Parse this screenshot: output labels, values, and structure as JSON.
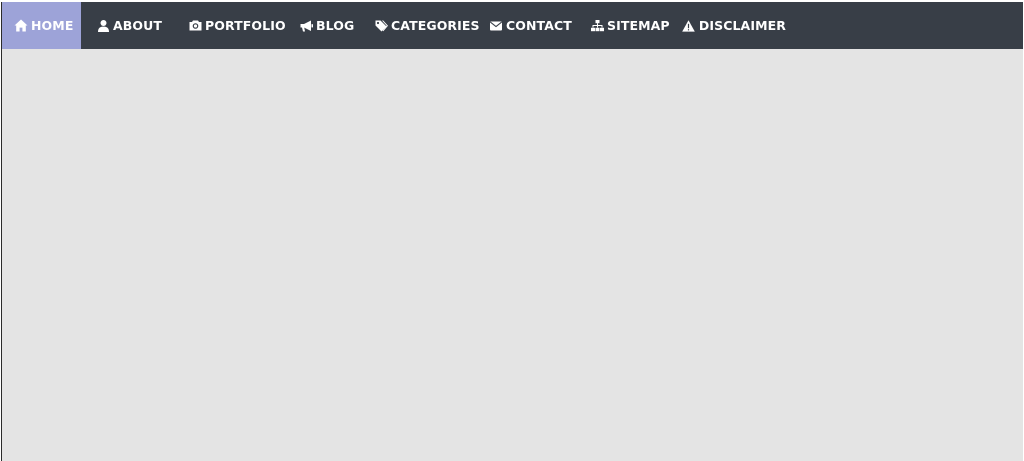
{
  "nav": {
    "items": [
      {
        "label": "HOME",
        "icon": "home-icon",
        "active": true
      },
      {
        "label": "ABOUT",
        "icon": "user-icon",
        "active": false
      },
      {
        "label": "PORTFOLIO",
        "icon": "camera-icon",
        "active": false
      },
      {
        "label": "BLOG",
        "icon": "megaphone-icon",
        "active": false
      },
      {
        "label": "CATEGORIES",
        "icon": "tags-icon",
        "active": false
      },
      {
        "label": "CONTACT",
        "icon": "envelope-icon",
        "active": false
      },
      {
        "label": "SITEMAP",
        "icon": "sitemap-icon",
        "active": false
      },
      {
        "label": "DISCLAIMER",
        "icon": "warning-icon",
        "active": false
      }
    ]
  },
  "colors": {
    "navbar_bg": "#383e47",
    "active_bg": "#9da3d8",
    "page_bg": "#e4e4e4",
    "text": "#ffffff"
  }
}
